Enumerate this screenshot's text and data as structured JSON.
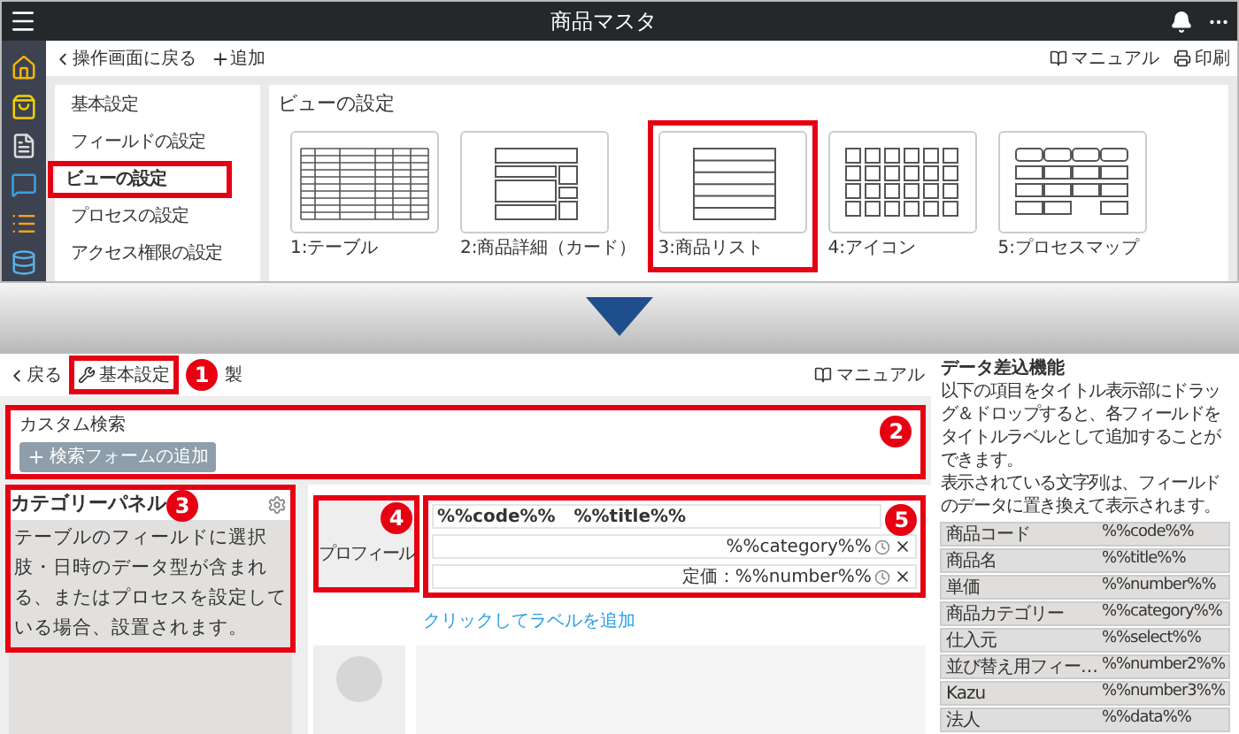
{
  "app_bar": {
    "title": "商品マスタ"
  },
  "top_toolbar": {
    "back": "操作画面に戻る",
    "add": "追加",
    "manual": "マニュアル",
    "print": "印刷"
  },
  "settings_menu": [
    {
      "label": "基本設定",
      "selected": false,
      "highlighted": false
    },
    {
      "label": "フィールドの設定",
      "selected": false,
      "highlighted": false
    },
    {
      "label": "ビューの設定",
      "selected": true,
      "highlighted": true
    },
    {
      "label": "プロセスの設定",
      "selected": false,
      "highlighted": false
    },
    {
      "label": "アクセス権限の設定",
      "selected": false,
      "highlighted": false
    }
  ],
  "view_settings": {
    "title": "ビューの設定",
    "views": [
      {
        "label": "1:テーブル",
        "kind": "table",
        "highlighted": false
      },
      {
        "label": "2:商品詳細（カード）",
        "kind": "card",
        "highlighted": false
      },
      {
        "label": "3:商品リスト",
        "kind": "list",
        "highlighted": true
      },
      {
        "label": "4:アイコン",
        "kind": "icon",
        "highlighted": false
      },
      {
        "label": "5:プロセスマップ",
        "kind": "process",
        "highlighted": false
      }
    ]
  },
  "editor_toolbar": {
    "back": "戻る",
    "basic_settings": "基本設定",
    "badge": "1",
    "duplicate": "製",
    "manual": "マニュアル"
  },
  "custom_search": {
    "title": "カスタム検索",
    "add_button": "検索フォームの追加",
    "badge": "2"
  },
  "category_panel": {
    "title": "カテゴリーパネル",
    "badge": "3",
    "description": "テーブルのフィールドに選択肢・日時のデータ型が含まれる、またはプロセスを設定している場合、設置されます。"
  },
  "profile": {
    "label": "プロフィール",
    "badge": "4"
  },
  "label_fields": {
    "badge": "5",
    "add_link": "クリックしてラベルを追加",
    "rows": [
      {
        "text": "%%code%%   %%title%%",
        "removable": false
      },
      {
        "text": "%%category%%",
        "removable": true
      },
      {
        "text": "定価：%%number%%",
        "removable": true
      }
    ]
  },
  "data_insert": {
    "title": "データ差込機能",
    "description": [
      "以下の項目をタイトル表示部にドラッグ＆ドロップすると、各フィールドをタイトルラベルとして追加することができます。",
      "表示されている文字列は、フィールドのデータに置き換えて表示されます。"
    ],
    "fields": [
      {
        "name": "商品コード",
        "token": "%%code%%"
      },
      {
        "name": "商品名",
        "token": "%%title%%"
      },
      {
        "name": "単価",
        "token": "%%number%%"
      },
      {
        "name": "商品カテゴリー",
        "token": "%%category%%"
      },
      {
        "name": "仕入元",
        "token": "%%select%%"
      },
      {
        "name": "並び替え用フィー…",
        "token": "%%number2%%"
      },
      {
        "name": "Kazu",
        "token": "%%number3%%"
      },
      {
        "name": "法人",
        "token": "%%data%%"
      }
    ]
  }
}
